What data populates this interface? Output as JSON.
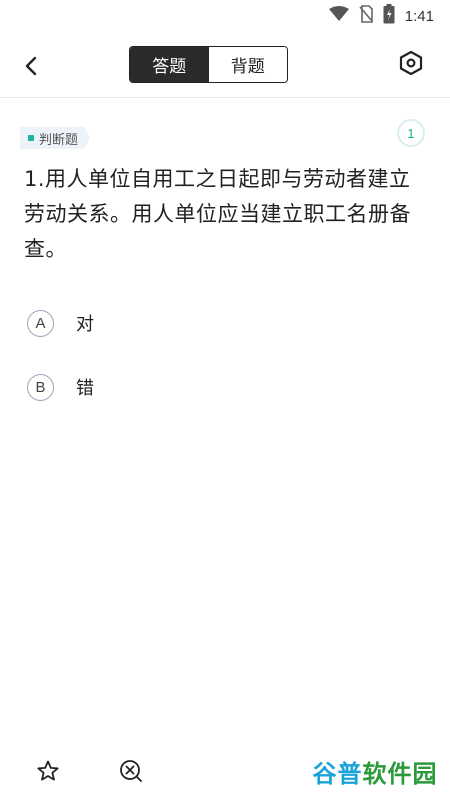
{
  "status_bar": {
    "time": "1:41"
  },
  "tabs": [
    {
      "label": "答题",
      "active": true
    },
    {
      "label": "背题",
      "active": false
    }
  ],
  "question": {
    "type_tag": "判断题",
    "number": "1",
    "text": "1.用人单位自用工之日起即与劳动者建立劳动关系。用人单位应当建立职工名册备查。"
  },
  "options": [
    {
      "letter": "A",
      "text": "对"
    },
    {
      "letter": "B",
      "text": "错"
    }
  ],
  "watermark": {
    "part1": "谷普",
    "part2": "软件园"
  },
  "colors": {
    "accent": "#19b5a0",
    "tab_active_bg": "#2b2b2b",
    "number_color": "#19b57a"
  },
  "icons": [
    "wifi-icon",
    "no-sim-icon",
    "battery-icon",
    "back-arrow-icon",
    "settings-hexagon-icon",
    "star-icon",
    "remove-circle-icon"
  ]
}
